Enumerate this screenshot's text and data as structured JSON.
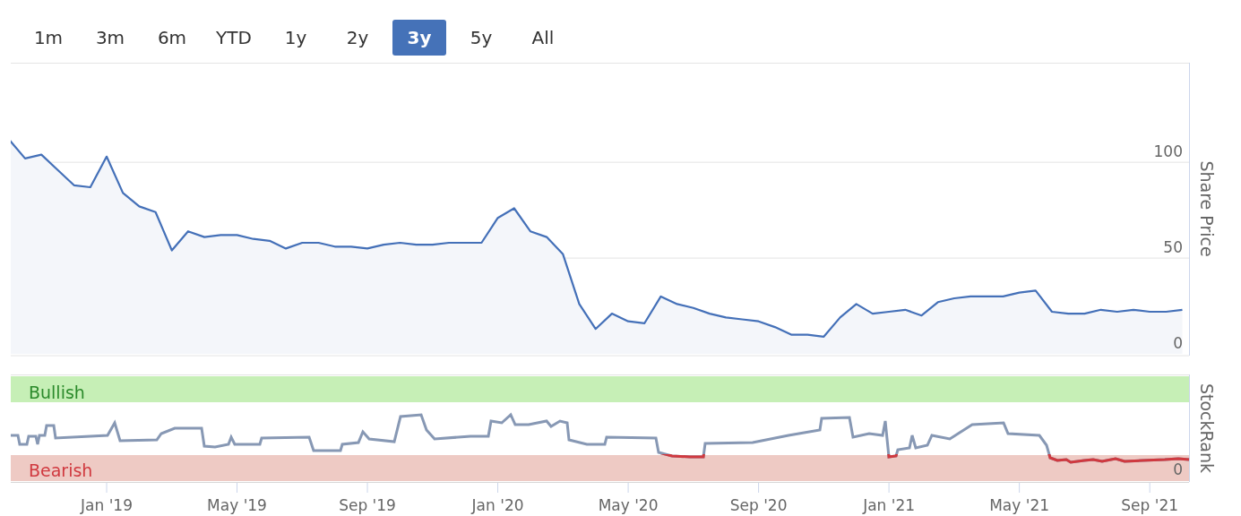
{
  "range_buttons": [
    {
      "label": "1m",
      "selected": false
    },
    {
      "label": "3m",
      "selected": false
    },
    {
      "label": "6m",
      "selected": false
    },
    {
      "label": "YTD",
      "selected": false
    },
    {
      "label": "1y",
      "selected": false
    },
    {
      "label": "2y",
      "selected": false
    },
    {
      "label": "3y",
      "selected": true
    },
    {
      "label": "5y",
      "selected": false
    },
    {
      "label": "All",
      "selected": false
    }
  ],
  "price_chart": {
    "chart_data": {
      "type": "area",
      "ylabel": "Share Price",
      "ylim": [
        0,
        152
      ],
      "yticks": [
        {
          "value": 0,
          "label": "0"
        },
        {
          "value": 50,
          "label": "50"
        },
        {
          "value": 100,
          "label": "100"
        }
      ],
      "series": [
        {
          "color": "#4470b8",
          "values": [
            112,
            102,
            104,
            96,
            88,
            87,
            103,
            84,
            77,
            74,
            54,
            64,
            61,
            62,
            62,
            60,
            59,
            55,
            58,
            58,
            56,
            56,
            55,
            57,
            58,
            57,
            57,
            58,
            58,
            58,
            71,
            76,
            64,
            61,
            52,
            26,
            13,
            21,
            17,
            16,
            30,
            26,
            24,
            21,
            19,
            18,
            17,
            14,
            10,
            10,
            9,
            19,
            26,
            21,
            22,
            23,
            20,
            27,
            29,
            30,
            30,
            30,
            32,
            33,
            22,
            21,
            21,
            23,
            22,
            23,
            22,
            22,
            23
          ]
        }
      ]
    }
  },
  "stockrank": {
    "label": "StockRank",
    "bullish_label": "Bullish",
    "bearish_label": "Bearish",
    "tick": "0"
  },
  "date_axis": [
    "Jan '19",
    "May '19",
    "Sep '19",
    "Jan '20",
    "May '20",
    "Sep '20",
    "Jan '21",
    "May '21",
    "Sep '21"
  ]
}
